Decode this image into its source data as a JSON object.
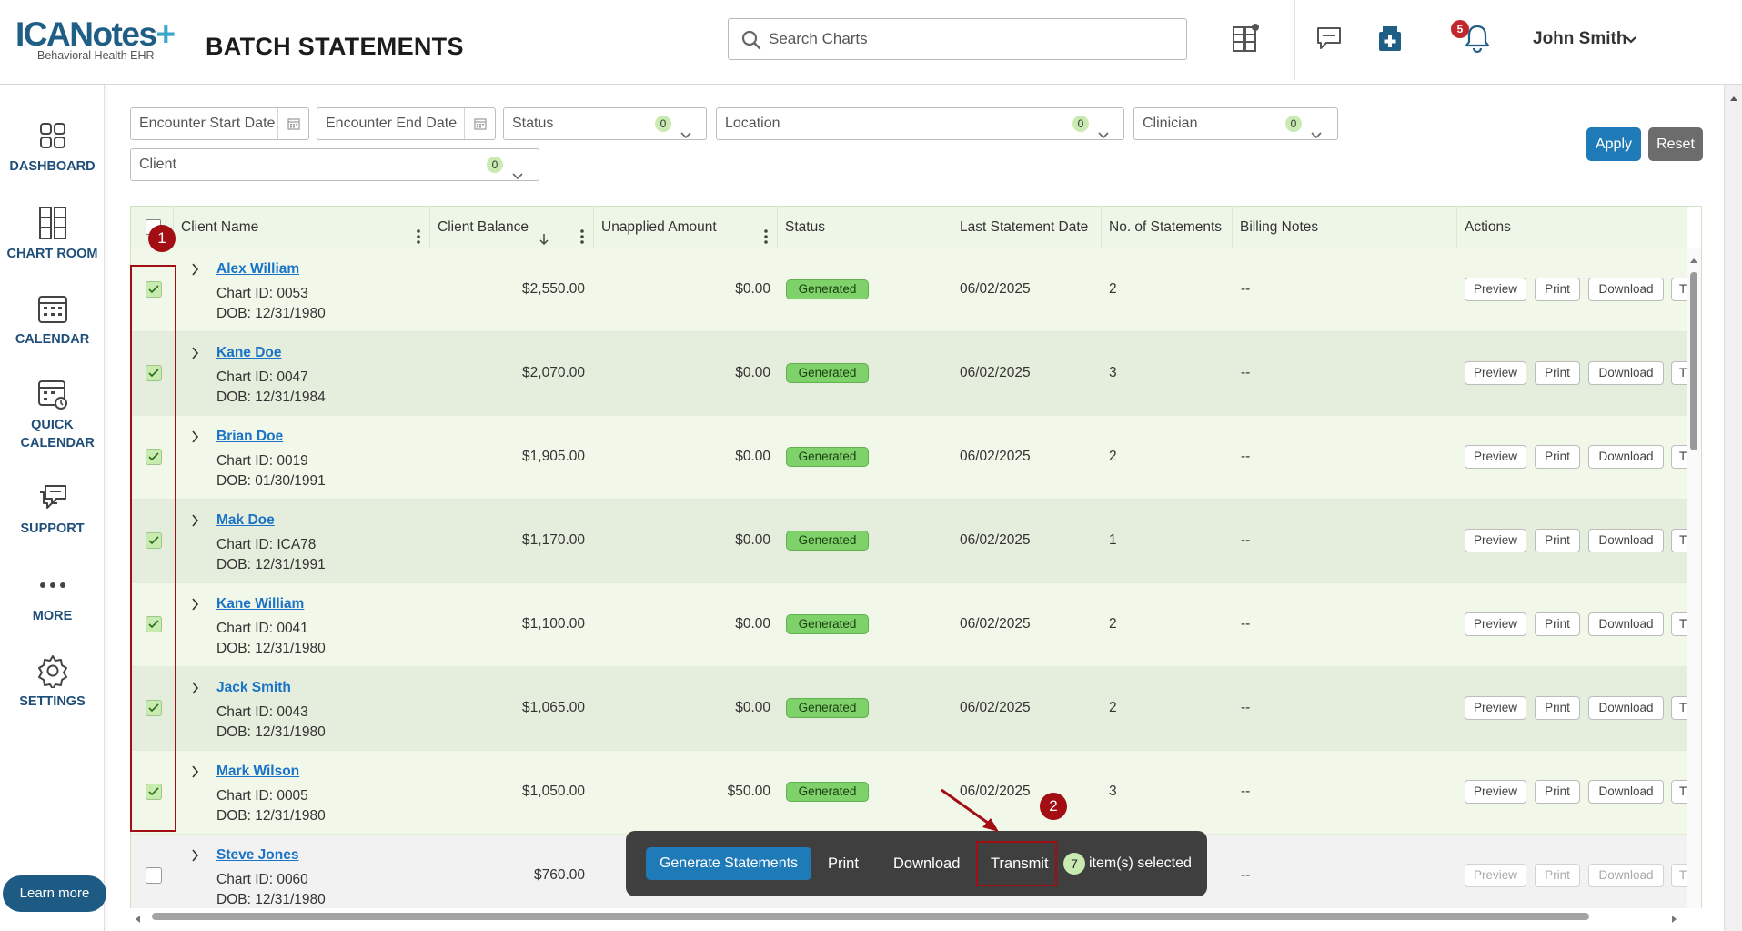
{
  "header": {
    "logo_main": "ICANotes",
    "logo_plus": "+",
    "logo_sub": "Behavioral Health EHR",
    "page_title": "BATCH STATEMENTS",
    "search_placeholder": "Search Charts",
    "notification_count": "5",
    "user_name": "John Smith"
  },
  "sidebar": {
    "items": [
      {
        "label": "DASHBOARD",
        "icon": "dashboard-icon"
      },
      {
        "label": "CHART ROOM",
        "icon": "chart-room-icon"
      },
      {
        "label": "CALENDAR",
        "icon": "calendar-icon"
      },
      {
        "label": "QUICK CALENDAR",
        "icon": "quick-calendar-icon"
      },
      {
        "label": "SUPPORT",
        "icon": "support-icon"
      },
      {
        "label": "MORE",
        "icon": "more-icon"
      },
      {
        "label": "SETTINGS",
        "icon": "settings-icon"
      }
    ],
    "learn_more": "Learn more"
  },
  "filters": {
    "encounter_start": "Encounter Start Date",
    "encounter_end": "Encounter End Date",
    "status": {
      "label": "Status",
      "count": "0"
    },
    "location": {
      "label": "Location",
      "count": "0"
    },
    "clinician": {
      "label": "Clinician",
      "count": "0"
    },
    "client": {
      "label": "Client",
      "count": "0"
    },
    "apply": "Apply",
    "reset": "Reset"
  },
  "table": {
    "columns": {
      "client_name": "Client Name",
      "client_balance": "Client Balance",
      "unapplied": "Unapplied Amount",
      "status": "Status",
      "last_statement": "Last Statement Date",
      "num_statements": "No. of Statements",
      "billing_notes": "Billing Notes",
      "actions": "Actions"
    },
    "action_labels": {
      "preview": "Preview",
      "print": "Print",
      "download": "Download",
      "transmit_cut": "T"
    },
    "rows": [
      {
        "name": "Alex William",
        "chart_id": "Chart ID: 0053",
        "dob": "DOB: 12/31/1980",
        "balance": "$2,550.00",
        "unapplied": "$0.00",
        "status": "Generated",
        "last_date": "06/02/2025",
        "count": "2",
        "notes": "--",
        "checked": true
      },
      {
        "name": "Kane Doe",
        "chart_id": "Chart ID: 0047",
        "dob": "DOB: 12/31/1984",
        "balance": "$2,070.00",
        "unapplied": "$0.00",
        "status": "Generated",
        "last_date": "06/02/2025",
        "count": "3",
        "notes": "--",
        "checked": true
      },
      {
        "name": "Brian Doe",
        "chart_id": "Chart ID: 0019",
        "dob": "DOB: 01/30/1991",
        "balance": "$1,905.00",
        "unapplied": "$0.00",
        "status": "Generated",
        "last_date": "06/02/2025",
        "count": "2",
        "notes": "--",
        "checked": true
      },
      {
        "name": "Mak Doe",
        "chart_id": "Chart ID: ICA78",
        "dob": "DOB: 12/31/1991",
        "balance": "$1,170.00",
        "unapplied": "$0.00",
        "status": "Generated",
        "last_date": "06/02/2025",
        "count": "1",
        "notes": "--",
        "checked": true
      },
      {
        "name": "Kane William",
        "chart_id": "Chart ID: 0041",
        "dob": "DOB: 12/31/1980",
        "balance": "$1,100.00",
        "unapplied": "$0.00",
        "status": "Generated",
        "last_date": "06/02/2025",
        "count": "2",
        "notes": "--",
        "checked": true
      },
      {
        "name": "Jack Smith",
        "chart_id": "Chart ID: 0043",
        "dob": "DOB: 12/31/1980",
        "balance": "$1,065.00",
        "unapplied": "$0.00",
        "status": "Generated",
        "last_date": "06/02/2025",
        "count": "2",
        "notes": "--",
        "checked": true
      },
      {
        "name": "Mark Wilson",
        "chart_id": "Chart ID: 0005",
        "dob": "DOB: 12/31/1980",
        "balance": "$1,050.00",
        "unapplied": "$50.00",
        "status": "Generated",
        "last_date": "06/02/2025",
        "count": "3",
        "notes": "--",
        "checked": true
      },
      {
        "name": "Steve Jones",
        "chart_id": "Chart ID: 0060",
        "dob": "DOB: 12/31/1980",
        "balance": "$760.00",
        "unapplied": "",
        "status": "",
        "last_date": "",
        "count": "",
        "notes": "--",
        "checked": false
      }
    ]
  },
  "selection_bar": {
    "generate": "Generate Statements",
    "print": "Print",
    "download": "Download",
    "transmit": "Transmit",
    "count": "7",
    "suffix": "item(s) selected"
  },
  "annotations": {
    "step1": "1",
    "step2": "2"
  },
  "colors": {
    "brand": "#1f5f86",
    "accent": "#1f7ab8",
    "annotation": "#a30d14",
    "status_generated": "#7fd16a"
  }
}
